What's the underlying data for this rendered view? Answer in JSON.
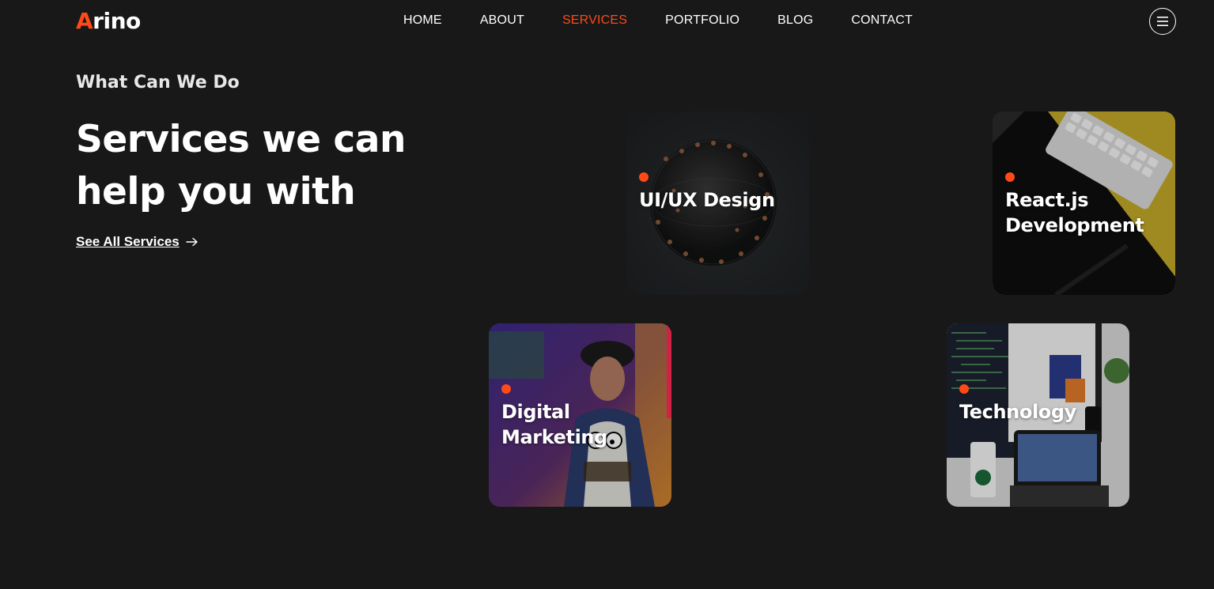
{
  "header": {
    "logo_accent": "A",
    "logo_rest": "rino",
    "nav": [
      {
        "label": "HOME"
      },
      {
        "label": "ABOUT"
      },
      {
        "label": "SERVICES"
      },
      {
        "label": "PORTFOLIO"
      },
      {
        "label": "BLOG"
      },
      {
        "label": "CONTACT"
      }
    ],
    "active_nav": "SERVICES",
    "menu_icon": "hamburger-menu-icon"
  },
  "hero": {
    "eyebrow": "What Can We Do",
    "headline": "Services we can help you with",
    "cta_label": "See All Services",
    "cta_icon": "arrow-right-icon"
  },
  "services": [
    {
      "title": "UI/UX Design"
    },
    {
      "title": "React.js Development"
    },
    {
      "title": "Digital Marketing"
    },
    {
      "title": "Technology"
    }
  ],
  "colors": {
    "accent": "#ff4a17",
    "background": "#181818",
    "text": "#ffffff"
  }
}
